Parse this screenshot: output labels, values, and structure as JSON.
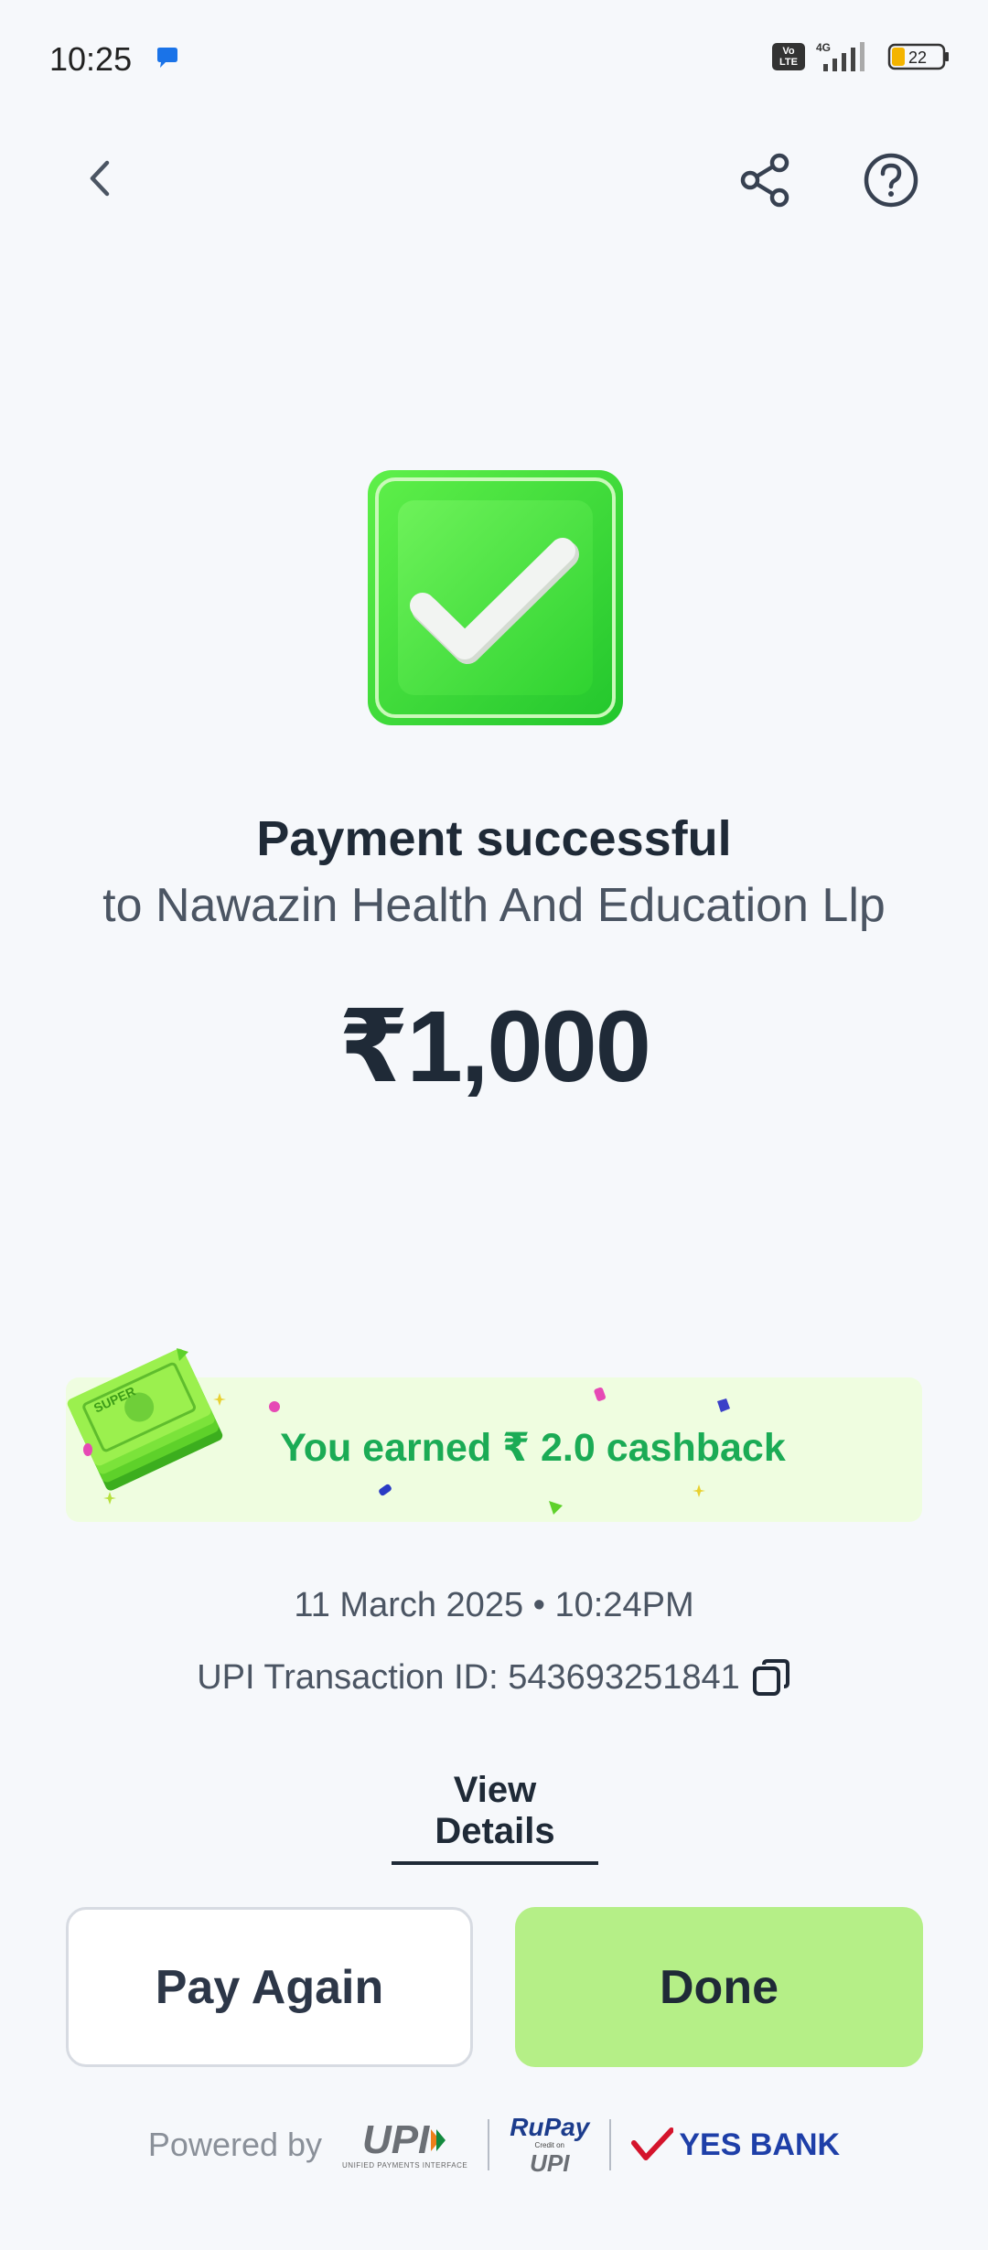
{
  "status_bar": {
    "time": "10:25",
    "network": "4G",
    "volte": "Vo LTE",
    "battery": "22"
  },
  "header": {
    "back_icon": "chevron-left-icon",
    "share_icon": "share-icon",
    "help_icon": "help-circle-icon"
  },
  "result": {
    "title": "Payment successful",
    "payee": "to Nawazin Health And Education Llp",
    "amount": "₹1,000"
  },
  "cashback": {
    "text": "You earned ₹ 2.0 cashback",
    "illustration_label": "SUPER"
  },
  "details": {
    "datetime": "11 March 2025 • 10:24PM",
    "transaction": "UPI Transaction ID: 543693251841",
    "view_details": "View Details"
  },
  "actions": {
    "pay_again": "Pay Again",
    "done": "Done"
  },
  "footer": {
    "powered_by": "Powered by",
    "upi": "UPI",
    "upi_sub": "UNIFIED PAYMENTS INTERFACE",
    "rupay": "RuPay",
    "rupay_credit": "Credit on",
    "rupay_upi": "UPI",
    "bank": "YES BANK"
  },
  "colors": {
    "background": "#f6f8fb",
    "success_green": "#36d93a",
    "cashback_text": "#1bab55",
    "cashback_bg": "#effde0",
    "done_button": "#b5ef87",
    "text_dark": "#1f2a37",
    "bank_blue": "#1e3fa8",
    "bank_red": "#d4142c"
  }
}
